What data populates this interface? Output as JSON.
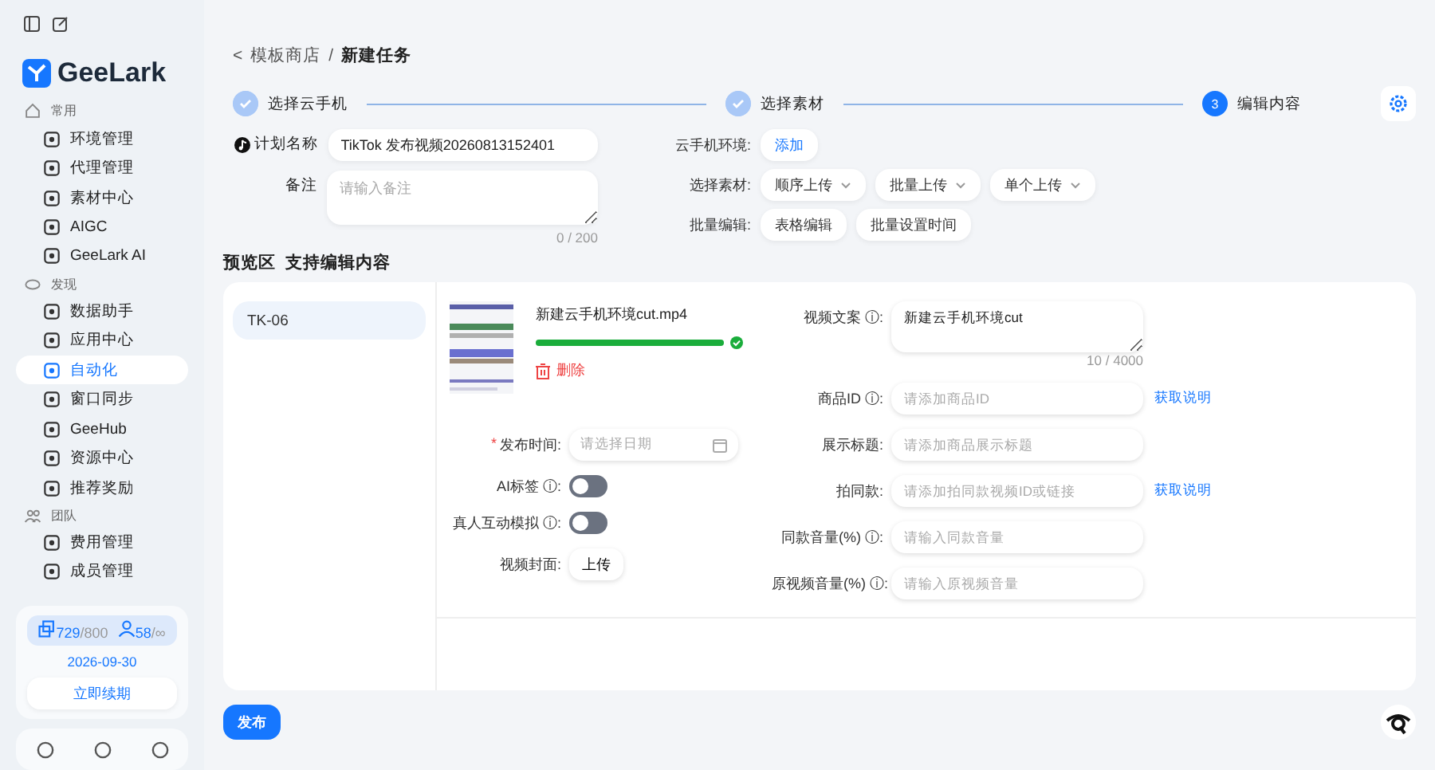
{
  "sidebar": {
    "brand": "GeeLark",
    "sections": [
      {
        "title": "常用",
        "items": [
          {
            "label": "环境管理",
            "selected": false
          },
          {
            "label": "代理管理",
            "selected": false
          },
          {
            "label": "素材中心",
            "selected": false
          },
          {
            "label": "AIGC",
            "selected": false
          },
          {
            "label": "GeeLark AI",
            "selected": false
          }
        ]
      },
      {
        "title": "发现",
        "items": [
          {
            "label": "数据助手",
            "selected": false
          },
          {
            "label": "应用中心",
            "selected": false
          },
          {
            "label": "自动化",
            "selected": true
          },
          {
            "label": "窗口同步",
            "selected": false
          },
          {
            "label": "GeeHub",
            "selected": false
          },
          {
            "label": "资源中心",
            "selected": false
          },
          {
            "label": "推荐奖励",
            "selected": false
          }
        ]
      },
      {
        "title": "团队",
        "items": [
          {
            "label": "费用管理",
            "selected": false
          },
          {
            "label": "成员管理",
            "selected": false
          }
        ]
      }
    ],
    "quota": {
      "profiles_used": "729",
      "profiles_total": "/800",
      "members_used": "58",
      "members_total": "/∞",
      "expiry": "2026-09-30",
      "renew": "立即续期"
    }
  },
  "breadcrumb": {
    "back": "<",
    "parent": "模板商店",
    "separator": "/",
    "current": "新建任务"
  },
  "steps": [
    {
      "label": "选择云手机",
      "completed": true
    },
    {
      "label": "选择素材",
      "completed": true
    },
    {
      "label": "编辑内容",
      "completed": false,
      "number": "3"
    }
  ],
  "plan": {
    "label": "计划名称",
    "value": "TikTok 发布视频20260813152401"
  },
  "note": {
    "label": "备注",
    "placeholder": "请输入备注",
    "counter": "0 / 200"
  },
  "options": [
    {
      "label": "云手机环境:",
      "buttons": [
        {
          "label": "添加",
          "kind": "link"
        }
      ]
    },
    {
      "label": "选择素材:",
      "buttons": [
        {
          "label": "顺序上传",
          "kind": "dropdown"
        },
        {
          "label": "批量上传",
          "kind": "dropdown"
        },
        {
          "label": "单个上传",
          "kind": "dropdown"
        }
      ]
    },
    {
      "label": "批量编辑:",
      "buttons": [
        {
          "label": "表格编辑",
          "kind": "plain"
        },
        {
          "label": "批量设置时间",
          "kind": "plain"
        }
      ]
    }
  ],
  "preview": {
    "title": "预览区",
    "subtitle": "支持编辑内容",
    "accounts": [
      {
        "label": "TK-06",
        "selected": true
      }
    ],
    "video": {
      "filename": "新建云手机环境cut.mp4",
      "level": 1,
      "delete": "删除"
    },
    "left_fields": [
      {
        "kind": "date",
        "required_mark": "*",
        "label": "发布时间:",
        "placeholder": "请选择日期"
      },
      {
        "kind": "toggle",
        "label": "AI标签 ⓘ:",
        "on": false
      },
      {
        "kind": "toggle",
        "label": "真人互动模拟 ⓘ:",
        "on": false
      },
      {
        "kind": "upload",
        "label": "视频封面:",
        "button": "上传"
      }
    ],
    "right_fields": [
      {
        "kind": "textarea",
        "label": "视频文案 ⓘ:",
        "value": "新建云手机环境cut",
        "counter": "10 / 4000"
      },
      {
        "kind": "input",
        "label": "商品ID ⓘ:",
        "placeholder": "请添加商品ID",
        "link": "获取说明"
      },
      {
        "kind": "input",
        "label": "展示标题:",
        "placeholder": "请添加商品展示标题"
      },
      {
        "kind": "input",
        "label": "拍同款:",
        "placeholder": "请添加拍同款视频ID或链接",
        "link": "获取说明"
      },
      {
        "kind": "input",
        "label": "同款音量(%) ⓘ:",
        "placeholder": "请输入同款音量"
      },
      {
        "kind": "input",
        "label": "原视频音量(%) ⓘ:",
        "placeholder": "请输入原视频音量"
      }
    ]
  },
  "publish_button": "发布"
}
